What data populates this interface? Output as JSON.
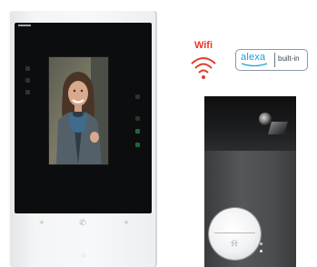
{
  "monitor": {
    "touch_buttons": [
      {
        "icon": "plus-icon",
        "glyph": "+"
      },
      {
        "icon": "handset-icon",
        "glyph": "✆"
      },
      {
        "icon": "plus-icon",
        "glyph": "+"
      }
    ],
    "speaker_glyph": "⁘"
  },
  "badges": {
    "wifi_label": "Wifi",
    "wifi_color": "#e33b2a",
    "alexa_word": "alexa",
    "alexa_color": "#1aa0d8",
    "alexa_suffix": "built-in"
  },
  "outdoor_panel": {
    "call_button_icon": "bell-icon",
    "bell_glyph": "⍾"
  }
}
